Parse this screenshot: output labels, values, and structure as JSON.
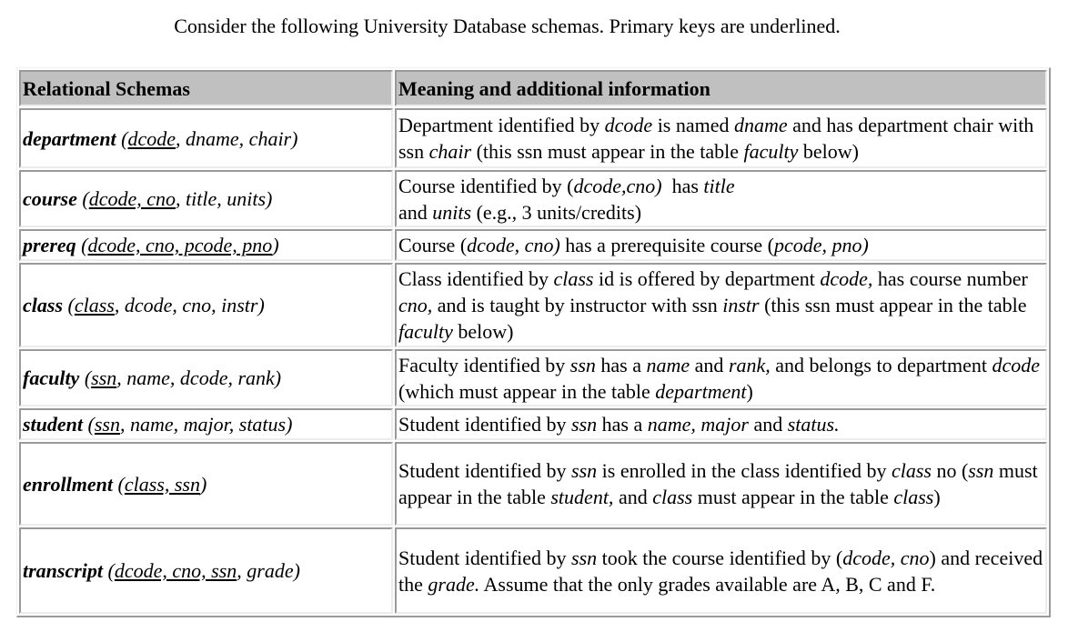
{
  "intro": "Consider the following University Database schemas. Primary keys are underlined.",
  "table": {
    "headers": [
      "Relational Schemas",
      "Meaning and additional information"
    ],
    "rows": [
      {
        "relation": "department",
        "pk_attrs": "dcode",
        "rest_attrs": ", dname, chair)",
        "meaning": [
          {
            "t": "Department identified by "
          },
          {
            "i": "dcode"
          },
          {
            "t": " is named "
          },
          {
            "i": "dname"
          },
          {
            "t": " and has department chair with ssn "
          },
          {
            "i": "chair"
          },
          {
            "t": " (this ssn must appear in the table "
          },
          {
            "i": "faculty"
          },
          {
            "t": " below)"
          }
        ]
      },
      {
        "relation": "course",
        "pk_attrs": "dcode, cno",
        "rest_attrs": ", title, units)",
        "meaning": [
          {
            "t": "Course identified by ("
          },
          {
            "i": "dcode,cno)"
          },
          {
            "t": "  has "
          },
          {
            "i": "title"
          },
          {
            "br": true
          },
          {
            "t": "and "
          },
          {
            "i": "units"
          },
          {
            "t": " (e.g., 3 units/credits)"
          }
        ]
      },
      {
        "relation": "prereq",
        "pk_attrs": "dcode, cno, pcode, pno",
        "rest_attrs": ")",
        "meaning": [
          {
            "t": "Course ("
          },
          {
            "i": "dcode, cno)"
          },
          {
            "t": " has a prerequisite course ("
          },
          {
            "i": "pcode, pno)"
          }
        ]
      },
      {
        "relation": "class",
        "pk_attrs": "class",
        "rest_attrs": ", dcode, cno, instr)",
        "meaning": [
          {
            "t": "Class identified by "
          },
          {
            "i": "class"
          },
          {
            "t": " id is offered by department "
          },
          {
            "i": "dcode,"
          },
          {
            "t": " has course number "
          },
          {
            "i": "cno,"
          },
          {
            "t": " and is taught by instructor with ssn "
          },
          {
            "i": "instr"
          },
          {
            "t": " (this ssn must appear in the table "
          },
          {
            "i": "faculty"
          },
          {
            "t": " below)"
          }
        ]
      },
      {
        "relation": "faculty",
        "pk_attrs": "ssn",
        "rest_attrs": ", name, dcode, rank)",
        "meaning": [
          {
            "t": "Faculty identified by "
          },
          {
            "i": "ssn"
          },
          {
            "t": " has a "
          },
          {
            "i": "name"
          },
          {
            "t": " and "
          },
          {
            "i": "rank,"
          },
          {
            "t": " and belongs to department "
          },
          {
            "i": "dcode"
          },
          {
            "t": " (which must appear in the table "
          },
          {
            "i": "department"
          },
          {
            "t": ")"
          }
        ]
      },
      {
        "relation": "student",
        "pk_attrs": "ssn",
        "rest_attrs": ", name, major, status)",
        "meaning": [
          {
            "t": "Student identified by "
          },
          {
            "i": "ssn"
          },
          {
            "t": " has a "
          },
          {
            "i": "name, major"
          },
          {
            "t": " and "
          },
          {
            "i": "status."
          }
        ]
      },
      {
        "relation": "enrollment",
        "pk_attrs": "class, ssn",
        "rest_attrs": ")",
        "meaning": [
          {
            "t": "Student identified by "
          },
          {
            "i": "ssn"
          },
          {
            "t": " is enrolled in the class identified by "
          },
          {
            "i": "class"
          },
          {
            "t": " no ("
          },
          {
            "i": "ssn"
          },
          {
            "t": " must appear in the table "
          },
          {
            "i": "student,"
          },
          {
            "t": " and "
          },
          {
            "i": "class"
          },
          {
            "t": " must appear in the table "
          },
          {
            "i": "class"
          },
          {
            "t": ")"
          }
        ]
      },
      {
        "relation": "transcript",
        "pk_attrs": "dcode, cno, ssn",
        "rest_attrs": ", grade)",
        "meaning": [
          {
            "t": "Student identified by "
          },
          {
            "i": "ssn"
          },
          {
            "t": " took the course identified by ("
          },
          {
            "i": "dcode, cno"
          },
          {
            "t": ") and received the "
          },
          {
            "i": "grade."
          },
          {
            "t": " Assume that the only grades available are A, B, C and F."
          }
        ]
      }
    ]
  }
}
